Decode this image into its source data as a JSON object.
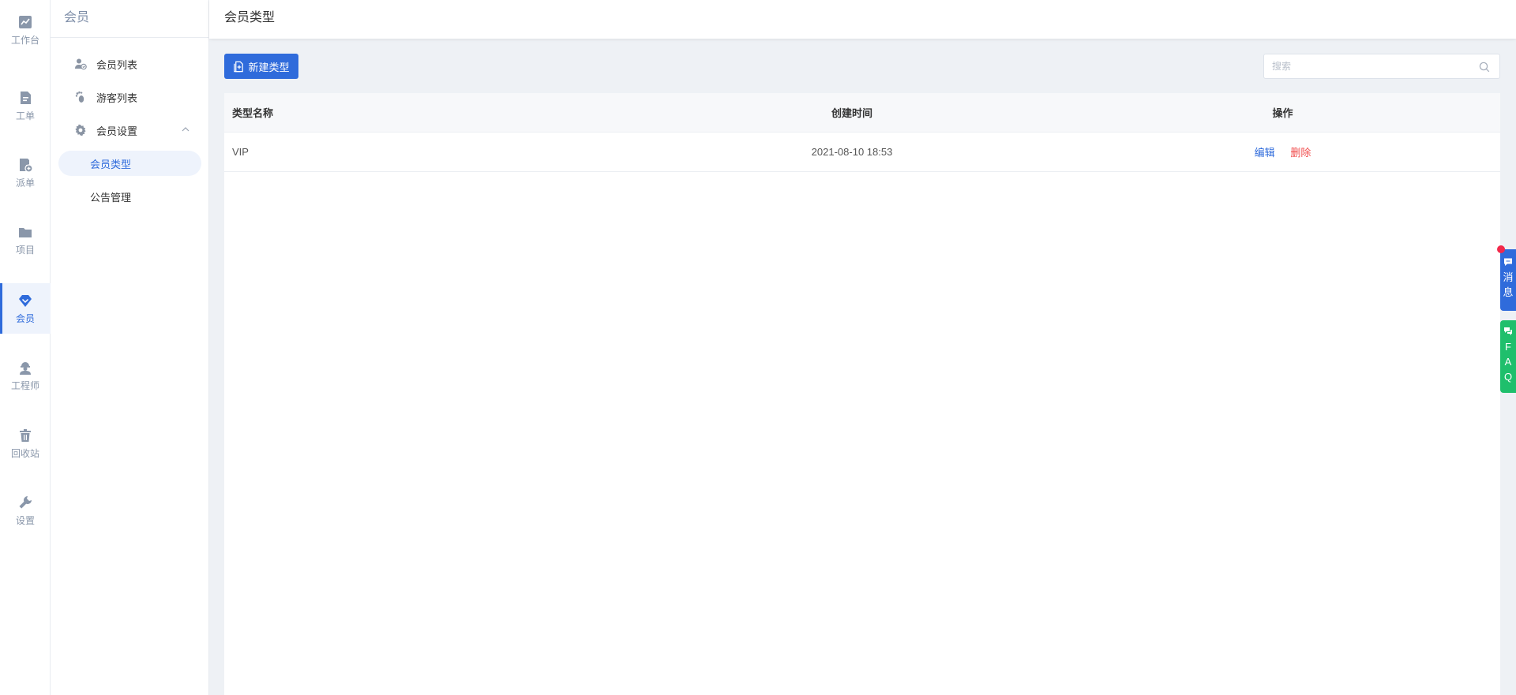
{
  "rail": {
    "items": [
      {
        "label": "工作台",
        "icon": "chart-line-icon"
      },
      {
        "label": "工单",
        "icon": "document-icon"
      },
      {
        "label": "派单",
        "icon": "dispatch-icon"
      },
      {
        "label": "项目",
        "icon": "folder-icon"
      },
      {
        "label": "会员",
        "icon": "diamond-icon",
        "active": true
      },
      {
        "label": "工程师",
        "icon": "engineer-icon"
      },
      {
        "label": "回收站",
        "icon": "trash-icon"
      },
      {
        "label": "设置",
        "icon": "wrench-icon"
      }
    ]
  },
  "submenu": {
    "title": "会员",
    "items": [
      {
        "label": "会员列表",
        "icon": "member-list-icon"
      },
      {
        "label": "游客列表",
        "icon": "footprint-icon"
      },
      {
        "label": "会员设置",
        "icon": "gear-icon",
        "expanded": true
      },
      {
        "label": "会员类型",
        "active": true
      },
      {
        "label": "公告管理"
      }
    ]
  },
  "header": {
    "title": "会员类型"
  },
  "toolbar": {
    "new_button_label": "新建类型",
    "search_placeholder": "搜索",
    "search_value": ""
  },
  "table": {
    "columns": [
      "类型名称",
      "创建时间",
      "操作"
    ],
    "rows": [
      {
        "name": "VIP",
        "created": "2021-08-10 18:53",
        "edit": "编辑",
        "delete": "删除"
      }
    ]
  },
  "float": {
    "message_label": "消息",
    "faq_label": "FAQ"
  },
  "colors": {
    "accent": "#2f6bdb",
    "danger": "#f04a4a",
    "faq": "#1fbf6c",
    "badge": "#f2294b"
  }
}
